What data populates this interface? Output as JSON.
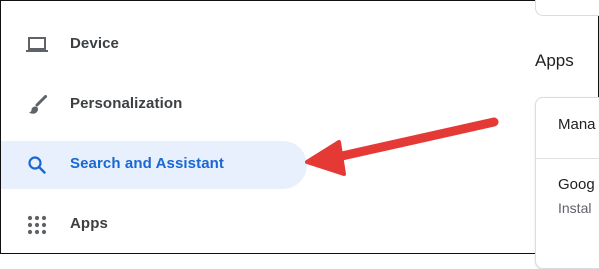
{
  "sidebar": {
    "items": [
      {
        "label": "Device",
        "icon": "laptop-icon",
        "active": false
      },
      {
        "label": "Personalization",
        "icon": "brush-icon",
        "active": false
      },
      {
        "label": "Search and Assistant",
        "icon": "search-icon",
        "active": true
      },
      {
        "label": "Apps",
        "icon": "apps-grid-icon",
        "active": false
      }
    ]
  },
  "main": {
    "section_title": "Apps",
    "rows": [
      {
        "title": "Mana"
      },
      {
        "title": "Goog",
        "subtitle": "Instal"
      }
    ]
  },
  "colors": {
    "active_bg": "#e8f0fe",
    "active_text": "#1967d2",
    "arrow": "#e53935"
  }
}
